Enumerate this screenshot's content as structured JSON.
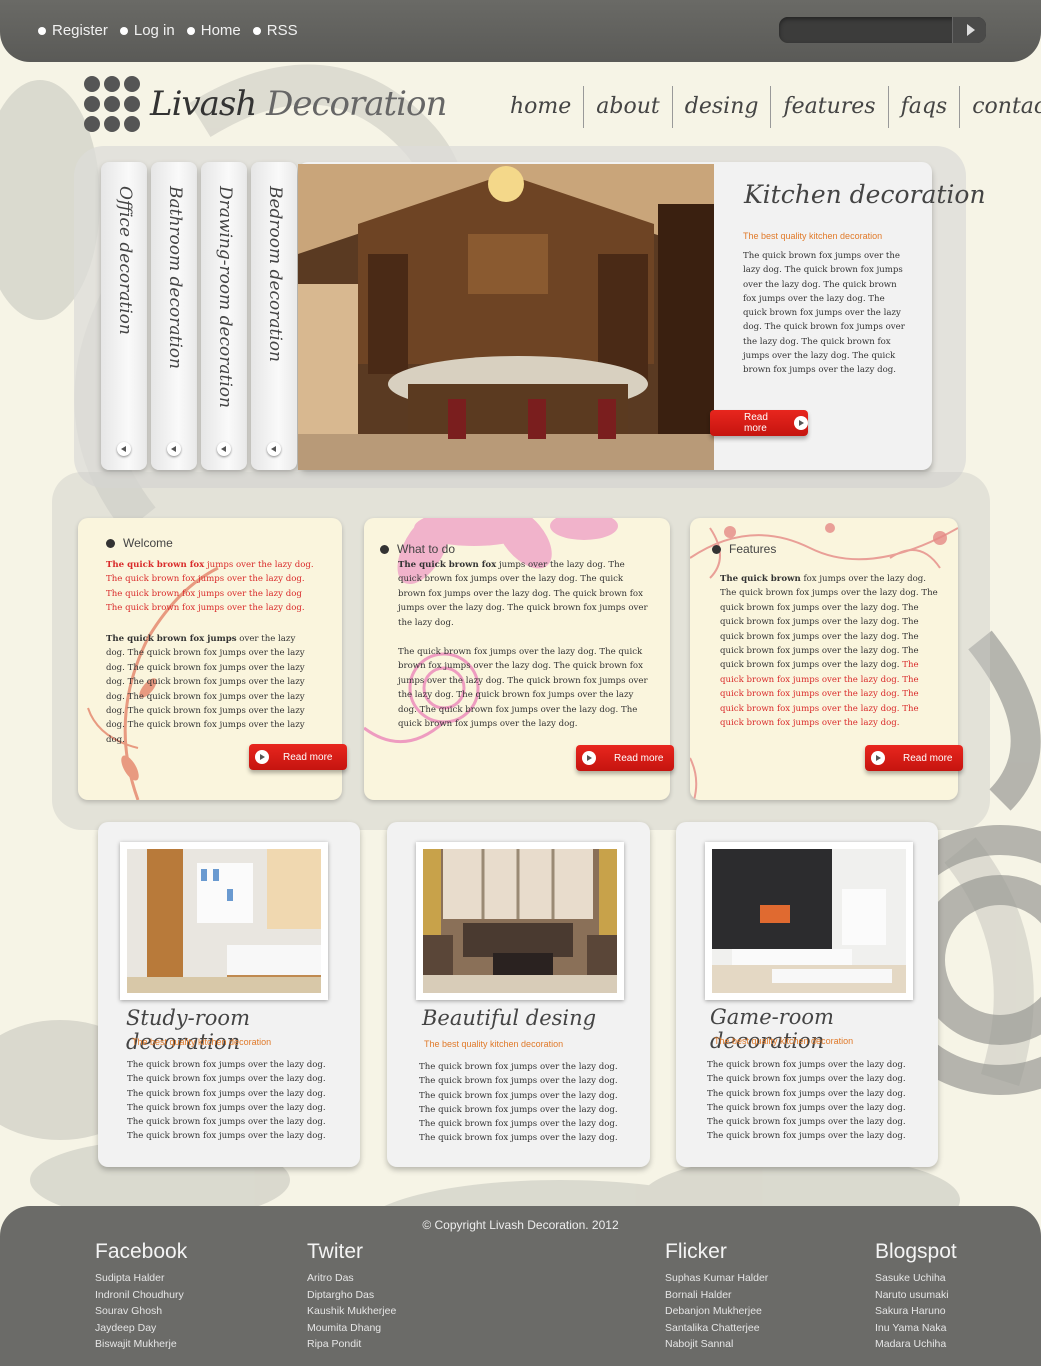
{
  "topbar": {
    "links": [
      "Register",
      "Log in",
      "Home",
      "RSS"
    ],
    "search_placeholder": ""
  },
  "brand": {
    "name_part1": "Livash",
    "name_part2": "Decoration"
  },
  "nav": [
    "home",
    "about",
    "desing",
    "features",
    "faqs",
    "contacts"
  ],
  "feature": {
    "tabs": [
      "Office decoration",
      "Bathroom decoration",
      "Drawing-room decoration",
      "Bedroom decoration"
    ],
    "title": "Kitchen decoration",
    "subtitle": "The best quality kitchen decoration",
    "text": "The quick brown fox jumps over the lazy dog. The quick brown fox jumps over the lazy dog. The quick brown fox jumps over the lazy dog. The quick brown fox jumps over the lazy dog. The quick brown fox jumps over the lazy dog. The quick brown fox jumps over the lazy dog. The quick brown fox jumps over the lazy dog.",
    "read_more": "Read more"
  },
  "boxes": [
    {
      "title": "Welcome",
      "p1_bold": "The quick brown fox",
      "p1_red": " jumps over the lazy dog. The quick brown fox jumps over the lazy dog. The quick brown fox jumps over the lazy dog The quick brown fox jumps over the lazy dog.",
      "p2_bold": "The quick brown fox jumps",
      "p2_text": " over the lazy dog. The quick brown fox jumps over the lazy dog. The quick brown fox jumps over the lazy dog. The quick brown fox jumps over the lazy dog. The quick brown fox jumps over the lazy dog. The quick brown fox jumps over the lazy dog. The quick brown fox jumps over the lazy dog.",
      "read_more": "Read more"
    },
    {
      "title": "What to do",
      "p1_bold": "The quick brown fox",
      "p1_text": " jumps over the lazy dog. The quick brown fox jumps over the lazy dog. The quick brown fox jumps over the lazy dog. The quick brown fox jumps over the lazy dog. The quick brown fox jumps over the lazy dog.",
      "p2_text": "The quick brown fox jumps over the lazy dog. The quick brown fox jumps over the lazy dog. The quick brown fox jumps over the lazy dog. The quick brown fox jumps over the lazy dog. The quick brown fox jumps over the lazy dog. The quick brown fox jumps over the lazy dog. The quick brown fox jumps over the lazy dog.",
      "read_more": "Read more"
    },
    {
      "title": "Features",
      "p1_bold": "The quick brown",
      "p1_text": " fox jumps over the lazy dog. The quick brown fox jumps over the lazy dog. The quick brown fox jumps over the lazy dog. The quick brown fox jumps over the lazy dog. The quick brown fox jumps over the lazy dog. The quick brown fox jumps over the lazy dog. The quick brown fox jumps over the lazy dog.",
      "p1_red": " The quick brown fox jumps over the lazy dog. The quick brown fox jumps over the lazy dog. The quick brown fox jumps over the lazy dog. The quick brown fox jumps over the lazy dog.",
      "read_more": "Read more"
    }
  ],
  "cards": [
    {
      "title": "Study-room decoration",
      "subtitle": "The best quality kitchen decoration",
      "text": "The quick brown fox jumps over the lazy dog. The quick brown fox jumps over the lazy dog. The quick brown fox jumps over the lazy dog. The quick brown fox jumps over the lazy dog. The quick brown fox jumps over the lazy dog. The quick brown fox jumps over the lazy dog."
    },
    {
      "title": "Beautiful desing",
      "subtitle": "The best quality kitchen decoration",
      "text": "The quick brown fox jumps over the lazy dog. The quick brown fox jumps over the lazy dog. The quick brown fox jumps over the lazy dog. The quick brown fox jumps over the lazy dog. The quick brown fox jumps over the lazy dog. The quick brown fox jumps over the lazy dog."
    },
    {
      "title": "Game-room decoration",
      "subtitle": "The best quality kitchen decoration",
      "text": "The quick brown fox jumps over the lazy dog. The quick brown fox jumps over the lazy dog. The quick brown fox jumps over the lazy dog. The quick brown fox jumps over the lazy dog. The quick brown fox jumps over the lazy dog. The quick brown fox jumps over the lazy dog."
    }
  ],
  "footer": {
    "copyright": "© Copyright Livash Decoration. 2012",
    "columns": [
      {
        "title": "Facebook",
        "items": [
          "Sudipta Halder",
          "Indronil Choudhury",
          "Sourav Ghosh",
          "Jaydeep Day",
          "Biswajit Mukherje"
        ]
      },
      {
        "title": "Twiter",
        "items": [
          "Aritro Das",
          "Diptargho Das",
          "Kaushik Mukherjee",
          "Moumita Dhang",
          "Ripa Pondit"
        ]
      },
      {
        "title": "Flicker",
        "items": [
          "Suphas Kumar Halder",
          "Bornali Halder",
          "Debanjon Mukherjee",
          "Santalika Chatterjee",
          "Nabojit Sannal"
        ]
      },
      {
        "title": "Blogspot",
        "items": [
          "Sasuke Uchiha",
          "Naruto usumaki",
          "Sakura Haruno",
          "Inu Yama Naka",
          "Madara Uchiha"
        ]
      }
    ]
  },
  "colors": {
    "accent_red": "#d7201a",
    "subtitle_orange": "#e07a2a",
    "bar_gray": "#666663",
    "page_bg": "#f6f4e6"
  }
}
